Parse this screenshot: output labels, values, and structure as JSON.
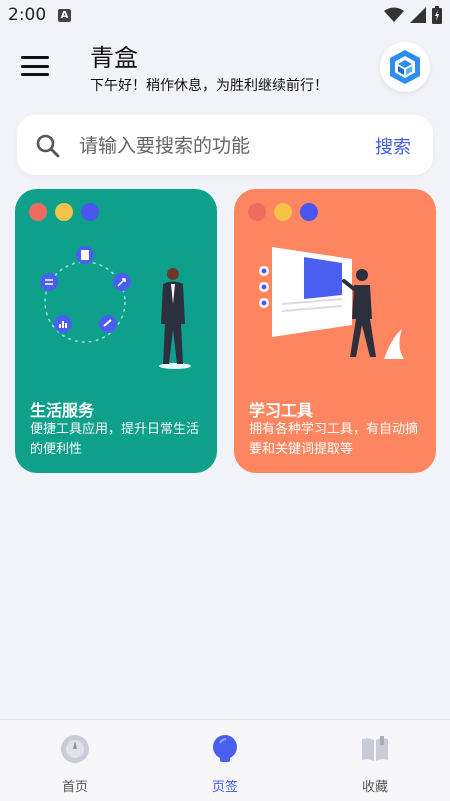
{
  "status": {
    "time": "2:00",
    "badge": "A"
  },
  "header": {
    "title": "青盒",
    "subtitle": "下午好！稍作休息，为胜利继续前行！"
  },
  "search": {
    "placeholder": "请输入要搜索的功能",
    "button_label": "搜索"
  },
  "cards": [
    {
      "title": "生活服务",
      "desc": "便捷工具应用，提升日常生活的便利性",
      "color": "#0fa08c"
    },
    {
      "title": "学习工具",
      "desc": "拥有各种学习工具，有自动摘要和关键词提取等",
      "color": "#fd8661"
    }
  ],
  "window_dots": [
    "#ef6b5f",
    "#f4c247",
    "#4b55f0"
  ],
  "nav": [
    {
      "label": "首页",
      "icon": "compass-icon",
      "active": false
    },
    {
      "label": "页签",
      "icon": "bulb-icon",
      "active": true
    },
    {
      "label": "收藏",
      "icon": "book-icon",
      "active": false
    }
  ],
  "colors": {
    "accent": "#3e5de0",
    "background": "#f2f3f8"
  }
}
